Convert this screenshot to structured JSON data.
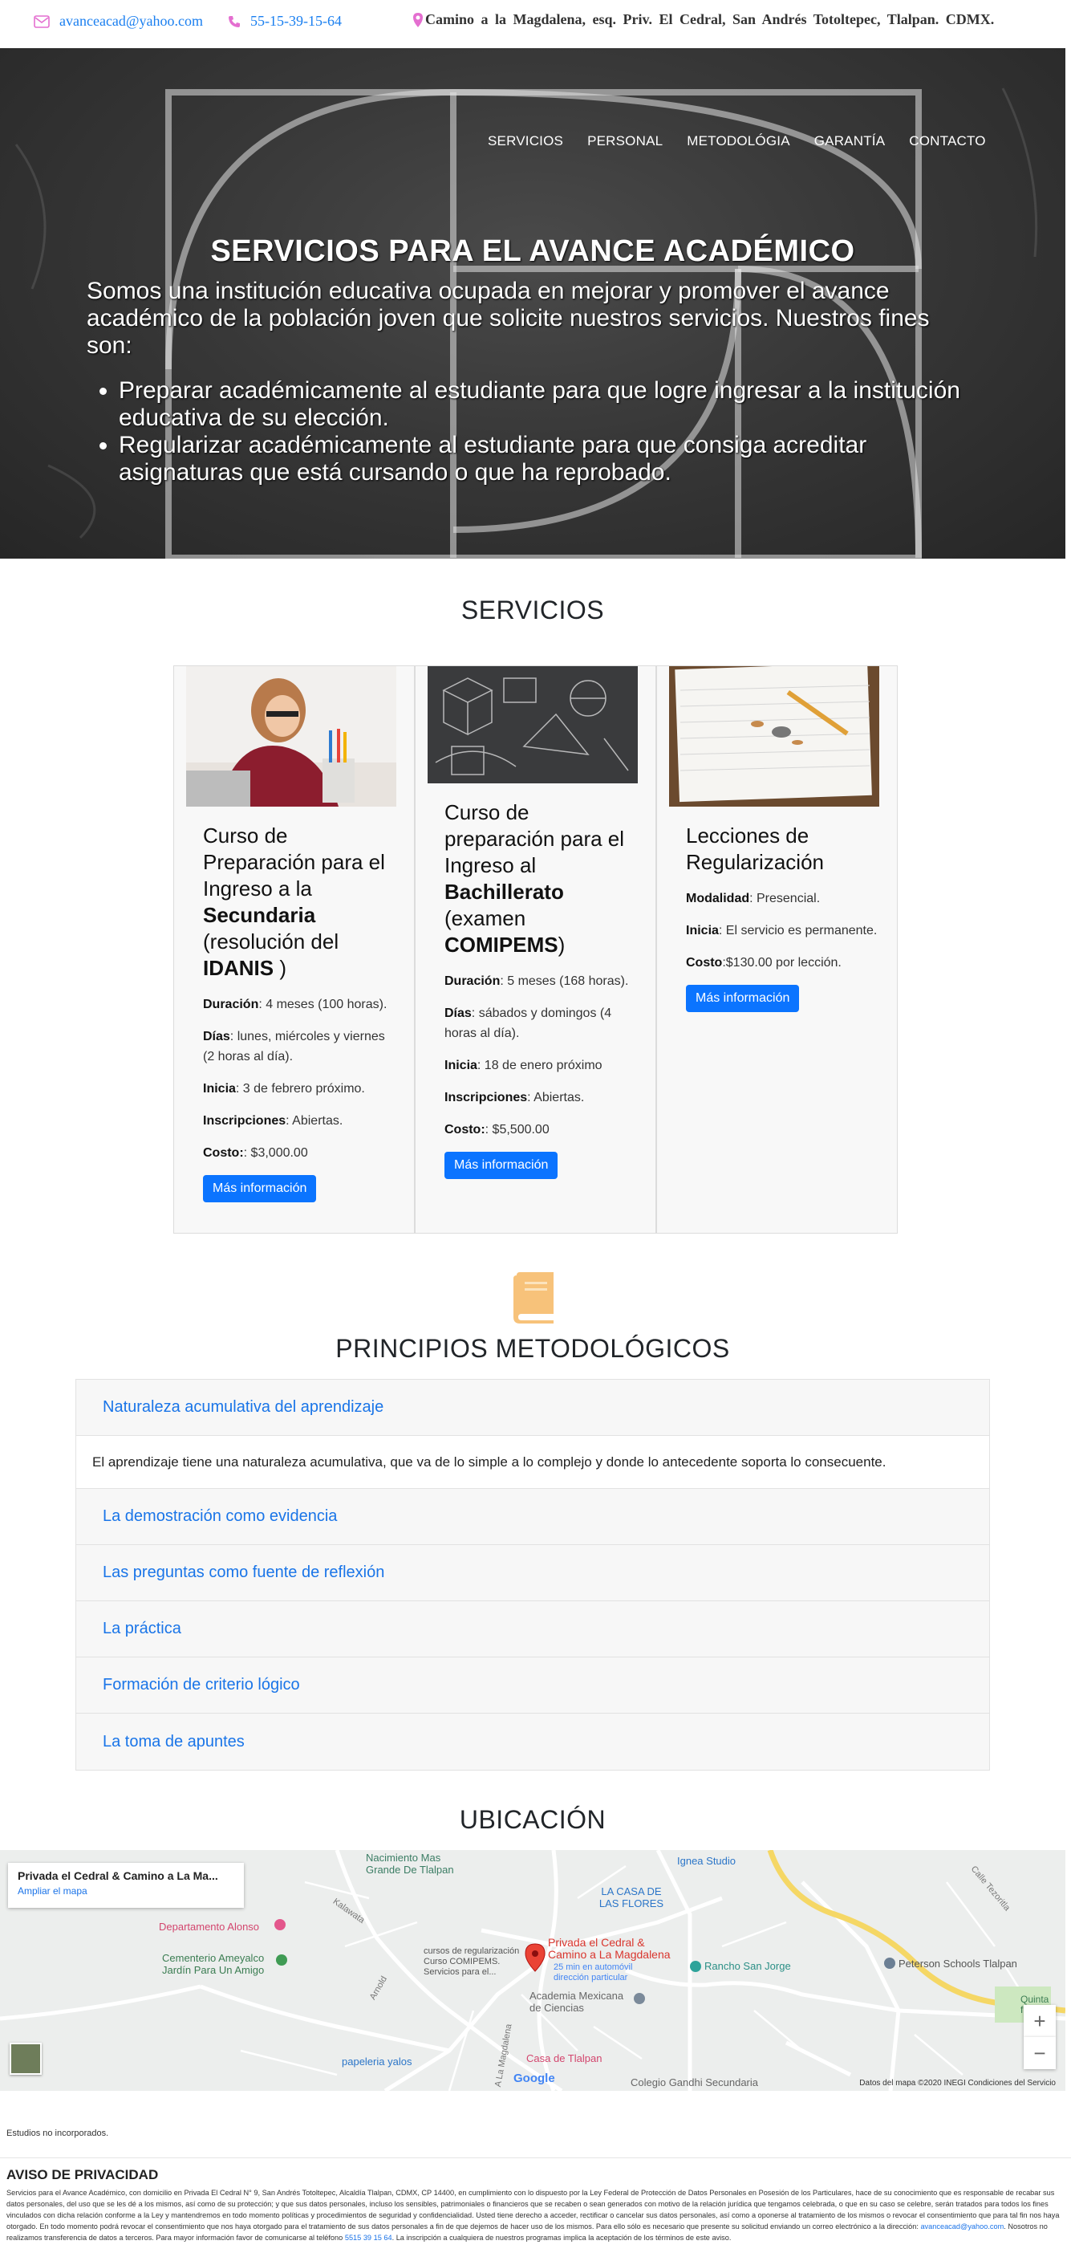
{
  "topbar": {
    "email": "avanceacad@yahoo.com",
    "phone": "55-15-39-15-64",
    "address": "Camino a la Magdalena, esq. Priv. El Cedral, San Andrés Totoltepec, Tlalpan. CDMX."
  },
  "nav": {
    "items": [
      "SERVICIOS",
      "PERSONAL",
      "METODOLÓGIA",
      "GARANTÍA",
      "CONTACTO"
    ]
  },
  "hero": {
    "title": "SERVICIOS PARA EL AVANCE ACADÉMICO",
    "intro": "Somos una institución educativa ocupada en mejorar y promover el avance académico de la población joven que solicite nuestros servicios. Nuestros fines son:",
    "goals": [
      "Preparar académicamente al estudiante para que logre ingresar a la institución educativa de su elección.",
      "Regularizar académicamente al estudiante para que consiga acreditar asignaturas que está cursando o que ha reprobado."
    ]
  },
  "services": {
    "title": "SERVICIOS",
    "cards": [
      {
        "title_a": "Curso de Preparación para el Ingreso a la ",
        "title_b": "Secundaria",
        "title_c": " (resolución del ",
        "title_d": "IDANIS",
        "title_e": " )",
        "rows": [
          {
            "label": "Duración",
            "value": ": 4 meses (100 horas)."
          },
          {
            "label": "Días",
            "value": ": lunes, miércoles y viernes (2 horas al día)."
          },
          {
            "label": "Inicia",
            "value": ": 3 de febrero próximo."
          },
          {
            "label": "Inscripciones",
            "value": ": Abiertas."
          },
          {
            "label": "Costo:",
            "value": ": $3,000.00"
          }
        ],
        "button": "Más información"
      },
      {
        "title_a": "Curso de preparación para el Ingreso al ",
        "title_b": "Bachillerato",
        "title_c": " (examen ",
        "title_d": "COMIPEMS",
        "title_e": ")",
        "rows": [
          {
            "label": "Duración",
            "value": ": 5 meses (168 horas)."
          },
          {
            "label": "Días",
            "value": ": sábados y domingos (4 horas al día)."
          },
          {
            "label": "Inicia",
            "value": ": 18 de enero próximo"
          },
          {
            "label": "Inscripciones",
            "value": ": Abiertas."
          },
          {
            "label": "Costo:",
            "value": ": $5,500.00"
          }
        ],
        "button": "Más información"
      },
      {
        "title_a": "Lecciones de Regularización",
        "rows": [
          {
            "label": "Modalidad",
            "value": ": Presencial."
          },
          {
            "label": "Inicia",
            "value": ": El servicio es permanente."
          },
          {
            "label": "Costo",
            "value": ":$130.00 por lección."
          }
        ],
        "button": "Más información"
      }
    ]
  },
  "methodology": {
    "title": "PRINCIPIOS METODOLÓGICOS",
    "items": [
      "Naturaleza acumulativa del aprendizaje",
      "La demostración como evidencia",
      "Las preguntas como fuente de reflexión",
      "La práctica",
      "Formación de criterio lógico",
      "La toma de apuntes"
    ],
    "open_body": "El aprendizaje tiene una naturaleza acumulativa, que va de lo simple a lo complejo y donde lo antecedente soporta lo consecuente."
  },
  "location": {
    "title": "UBICACIÓN",
    "card_title": "Privada el Cedral & Camino a La Ma...",
    "card_link": "Ampliar el mapa",
    "pois": {
      "nacimiento": "Nacimiento Mas Grande De Tlalpan",
      "ignea": "Ignea Studio",
      "flores": "LA CASA DE LAS FLORES",
      "alonso": "Departamento Alonso",
      "cementerio": "Cementerio Ameyalco Jardín Para Un Amigo",
      "cursos": "cursos de regularización Curso COMIPEMS. Servicios para el...",
      "pin_title": "Privada el Cedral & Camino a La Magdalena",
      "pin_sub": "25 min en automóvil dirección particular",
      "rancho": "Rancho San Jorge",
      "peterson": "Peterson Schools Tlalpan",
      "quinta": "Quinta flores",
      "academia": "Academia Mexicana de Ciencias",
      "papeleria": "papeleria yalos",
      "casa": "Casa de Tlalpan",
      "gandhi": "Colegio Gandhi Secundaria",
      "google": "Google",
      "credits": "Datos del mapa ©2020 INEGI    Condiciones del Servicio",
      "calle": "Calle Tezoritla",
      "kalawata": "Kalawata",
      "arnold": "Arnold",
      "magdalena": "A La Magdalena"
    }
  },
  "footer": {
    "note": "Estudios no incorporados.",
    "privacy_title": "AVISO DE PRIVACIDAD",
    "privacy_text": "Servicios para el Avance Académico, con domicilio en Privada El Cedral N° 9, San Andrés Totoltepec, Alcaldía Tlalpan, CDMX, CP 14400, en cumplimiento con lo dispuesto por la Ley Federal de Protección de Datos Personales en Posesión de los Particulares, hace de su conocimiento que es responsable de recabar sus datos personales, del uso que se les dé a los mismos, así como de su protección; y que sus datos personales, incluso los sensibles, patrimoniales o financieros que se recaben o sean generados con motivo de la relación jurídica que tengamos celebrada, o que en su caso se celebre, serán tratados para todos los fines vinculados con dicha relación conforme a la Ley y mantendremos en todo momento políticas y procedimientos de seguridad y confidencialidad. Usted tiene derecho a acceder, rectificar o cancelar sus datos personales, así como a oponerse al tratamiento de los mismos o revocar el consentimiento que para tal fin nos haya otorgado. En todo momento podrá revocar el consentimiento que nos haya otorgado para el tratamiento de sus datos personales a fin de que dejemos de hacer uso de los mismos. Para ello sólo es necesario que presente su solicitud enviando un correo electrónico a la dirección:",
    "privacy_email": "avanceacad@yahoo.com",
    "privacy_text2": ". Nosotros no realizamos transferencia de datos a terceros. Para mayor información favor de comunicarse al teléfono",
    "privacy_phone": "5515 39 15 64",
    "privacy_text3": ". La inscripción a cualquiera de nuestros programas implica la aceptación de los términos de este aviso."
  },
  "colors": {
    "link": "#1a75e8",
    "button": "#0b74ff",
    "icon_pink": "#e46fd0",
    "book_icon": "#f7c27a"
  }
}
